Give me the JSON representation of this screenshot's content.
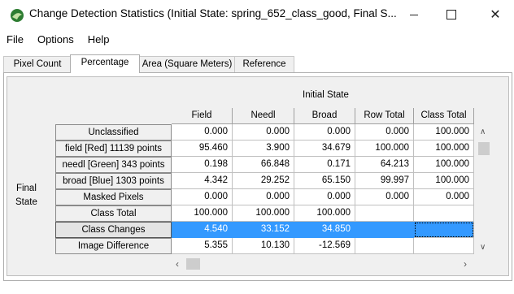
{
  "window": {
    "title": "Change Detection Statistics (Initial State: spring_652_class_good, Final S...",
    "minimize_glyph": "—",
    "maximize_glyph": "☐",
    "close_glyph": "✕"
  },
  "menu": [
    "File",
    "Options",
    "Help"
  ],
  "tabs": [
    "Pixel Count",
    "Percentage",
    "Area (Square Meters)",
    "Reference"
  ],
  "active_tab": "Percentage",
  "table": {
    "group_header": "Initial State",
    "side_label_line1": "Final",
    "side_label_line2": "State",
    "columns": [
      "Field",
      "Needl",
      "Broad",
      "Row Total",
      "Class Total"
    ],
    "rows": [
      {
        "label": "Unclassified",
        "values": [
          "0.000",
          "0.000",
          "0.000",
          "0.000",
          "100.000"
        ]
      },
      {
        "label": "field [Red] 11139 points",
        "values": [
          "95.460",
          "3.900",
          "34.679",
          "100.000",
          "100.000"
        ]
      },
      {
        "label": "needl [Green] 343 points",
        "values": [
          "0.198",
          "66.848",
          "0.171",
          "64.213",
          "100.000"
        ]
      },
      {
        "label": "broad [Blue] 1303 points",
        "values": [
          "4.342",
          "29.252",
          "65.150",
          "99.997",
          "100.000"
        ]
      },
      {
        "label": "Masked Pixels",
        "values": [
          "0.000",
          "0.000",
          "0.000",
          "0.000",
          "0.000"
        ]
      },
      {
        "label": "Class Total",
        "values": [
          "100.000",
          "100.000",
          "100.000",
          "",
          ""
        ]
      },
      {
        "label": "Class Changes",
        "values": [
          "4.540",
          "33.152",
          "34.850",
          "",
          ""
        ]
      },
      {
        "label": "Image Difference",
        "values": [
          "5.355",
          "10.130",
          "-12.569",
          "",
          ""
        ]
      }
    ],
    "selected_row": "Class Changes"
  },
  "colors": {
    "selection": "#3399ff",
    "app_icon": "#7cb342"
  },
  "icons": {
    "app": "app-icon",
    "scroll_up": "chevron-up-icon",
    "scroll_down": "chevron-down-icon",
    "scroll_left": "chevron-left-icon",
    "scroll_right": "chevron-right-icon"
  }
}
